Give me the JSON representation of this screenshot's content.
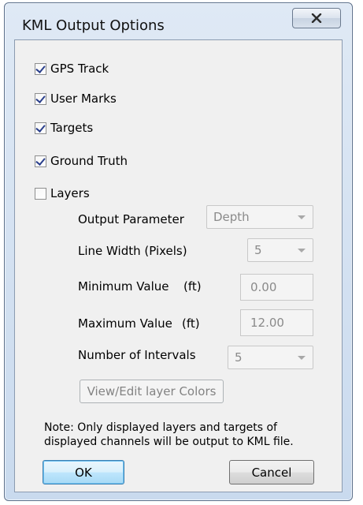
{
  "dialog": {
    "title": "KML Output Options",
    "close_icon": "close-x-icon"
  },
  "options": {
    "gps_track": {
      "label": "GPS Track",
      "checked": true
    },
    "user_marks": {
      "label": "User Marks",
      "checked": true
    },
    "targets": {
      "label": "Targets",
      "checked": true
    },
    "ground_truth": {
      "label": "Ground Truth",
      "checked": true
    },
    "layers": {
      "label": "Layers",
      "checked": false
    }
  },
  "layers_settings": {
    "output_parameter": {
      "label": "Output Parameter",
      "value": "Depth"
    },
    "line_width": {
      "label": "Line Width (Pixels)",
      "value": "5"
    },
    "minimum_value": {
      "label": "Minimum Value",
      "unit": "(ft)",
      "value": "0.00"
    },
    "maximum_value": {
      "label": "Maximum Value",
      "unit": "(ft)",
      "value": "12.00"
    },
    "number_of_intervals": {
      "label": "Number of Intervals",
      "value": "5"
    },
    "edit_colors_button": "View/Edit layer Colors"
  },
  "note": {
    "line1": "Note: Only displayed layers and targets of",
    "line2": "displayed channels will be output to KML file."
  },
  "buttons": {
    "ok": "OK",
    "cancel": "Cancel"
  }
}
